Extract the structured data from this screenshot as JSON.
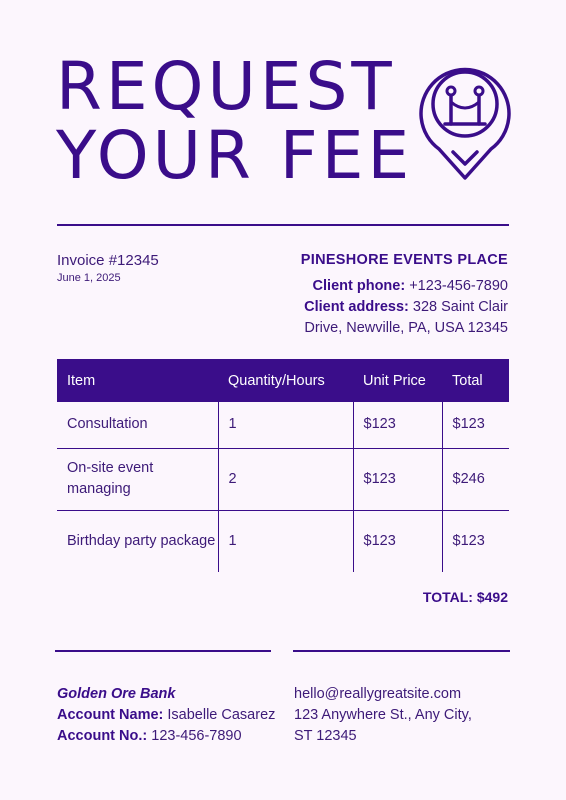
{
  "title": {
    "line1": "REQUEST",
    "line2": "YOUR FEE"
  },
  "logo": {
    "icon": "location-pin-icon"
  },
  "invoice": {
    "number": "Invoice #12345",
    "date": "June 1, 2025"
  },
  "client": {
    "company": "PINESHORE EVENTS PLACE",
    "phone_label": "Client phone:",
    "phone": "+123-456-7890",
    "address_label": "Client address:",
    "address_line1": "328 Saint Clair",
    "address_line2": "Drive, Newville, PA, USA 12345"
  },
  "table": {
    "headers": [
      "Item",
      "Quantity/Hours",
      "Unit Price",
      "Total"
    ],
    "rows": [
      {
        "item": "Consultation",
        "qty": "1",
        "unit": "$123",
        "total": "$123"
      },
      {
        "item": "On-site event managing",
        "qty": "2",
        "unit": "$123",
        "total": "$246"
      },
      {
        "item": "Birthday party package",
        "qty": "1",
        "unit": "$123",
        "total": "$123"
      }
    ]
  },
  "total": {
    "label": "TOTAL:",
    "value": "$492"
  },
  "bank": {
    "name": "Golden Ore Bank",
    "account_name_label": "Account Name:",
    "account_name": "Isabelle Casarez",
    "account_no_label": "Account No.:",
    "account_no": "123-456-7890"
  },
  "contact": {
    "email": "hello@reallygreatsite.com",
    "address_line1": "123 Anywhere St., Any City,",
    "address_line2": "ST 12345"
  },
  "colors": {
    "accent": "#3a0d8a",
    "text": "#3d1a78",
    "background": "#fcf6fd"
  }
}
